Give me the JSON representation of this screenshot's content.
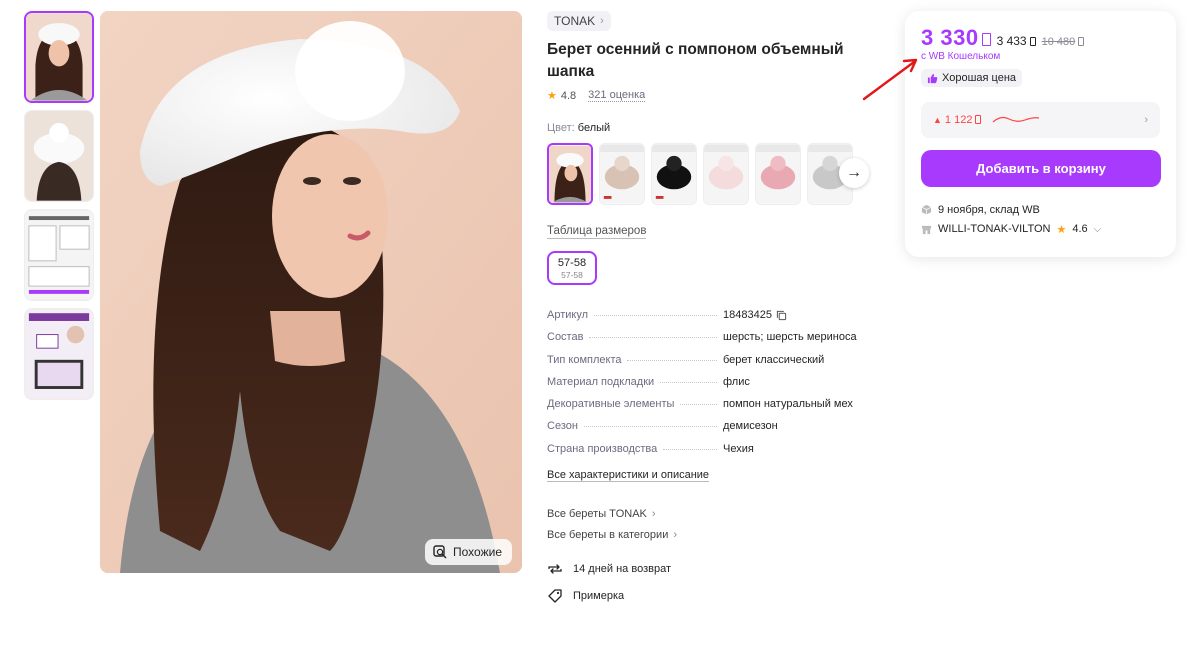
{
  "gallery": {
    "thumbnails": [
      {
        "label": "thumbnail-1",
        "active": true
      },
      {
        "label": "thumbnail-2",
        "active": false
      },
      {
        "label": "thumbnail-3",
        "active": false
      },
      {
        "label": "thumbnail-4",
        "active": false
      }
    ],
    "similar_button_label": "Похожие"
  },
  "product": {
    "brand": "TONAK",
    "title": "Берет осенний с помпоном объемный шапка",
    "rating": "4.8",
    "reviews": "321 оценка",
    "color_label": "Цвет:",
    "color_value": "белый",
    "swatches": [
      "белый",
      "бежевый",
      "черный",
      "светло-розовый",
      "розовый",
      "серый"
    ],
    "size_table_label": "Таблица размеров",
    "size": {
      "label": "57-58",
      "sub": "57-58"
    },
    "specs": [
      {
        "key": "Артикул",
        "value": "18483425"
      },
      {
        "key": "Состав",
        "value": "шерсть; шерсть мериноса"
      },
      {
        "key": "Тип комплекта",
        "value": "берет классический"
      },
      {
        "key": "Материал подкладки",
        "value": "флис"
      },
      {
        "key": "Декоративные элементы",
        "value": "помпон натуральный мех"
      },
      {
        "key": "Сезон",
        "value": "демисезон"
      },
      {
        "key": "Страна производства",
        "value": "Чехия"
      }
    ],
    "all_specs_label": "Все характеристики и описание",
    "links": {
      "brand_berets": "Все береты TONAK",
      "category_berets": "Все береты в категории"
    },
    "features": {
      "returns": "14 дней на возврат",
      "fitting": "Примерка"
    }
  },
  "buy_box": {
    "price": "3 330",
    "price_without_wallet": "3 433",
    "old_price": "10 480",
    "wallet_note": "с WB Кошельком",
    "good_price_label": "Хорошая цена",
    "price_increase": "1 122",
    "add_to_cart_label": "Добавить в корзину",
    "delivery": "9 ноября, склад WB",
    "seller_name": "WILLI-TONAK-VILTON",
    "seller_rating": "4.6"
  },
  "colors": {
    "accent": "#a73afd",
    "alert_red": "#ff4444",
    "star": "#ff9f0a",
    "annotation_arrow": "#e01818"
  }
}
